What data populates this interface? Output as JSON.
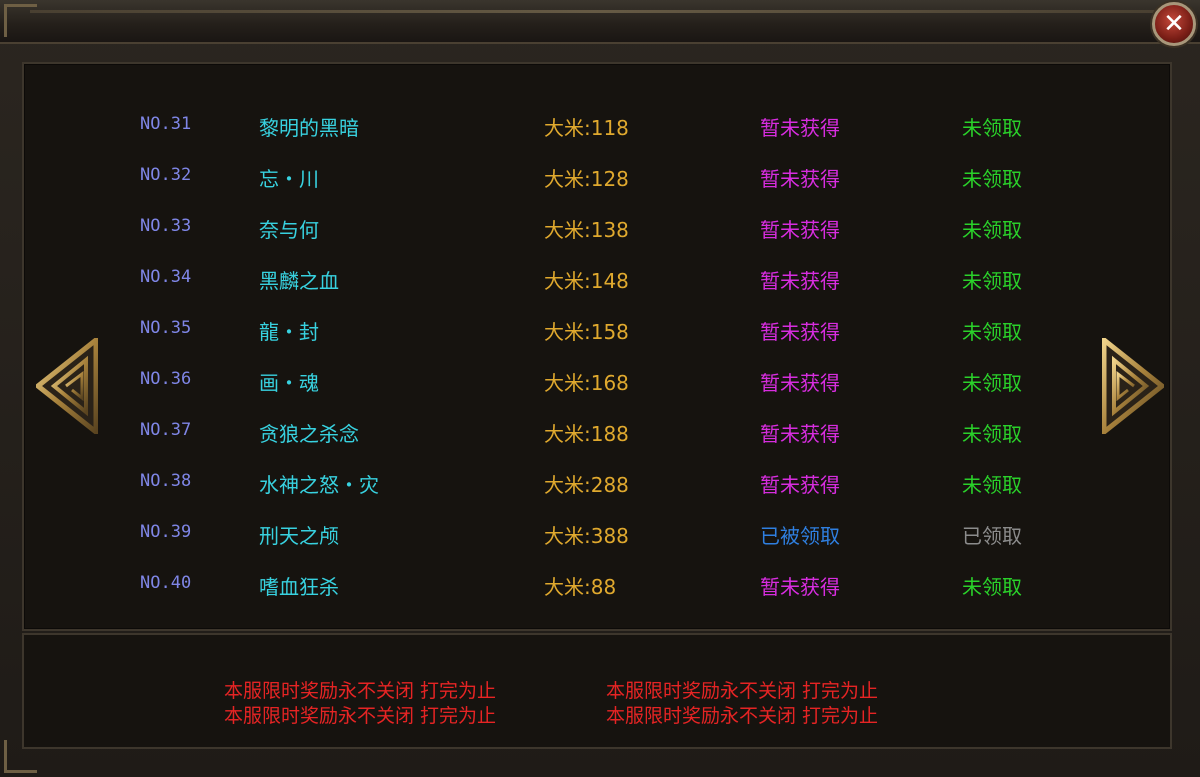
{
  "window": {
    "close_icon": "close-icon",
    "close_glyph": "✕"
  },
  "colors": {
    "no": "#7f86e6",
    "name": "#38d2e0",
    "price": "#e0a92e",
    "not_obtained": "#d82de0",
    "claimed_by_other": "#2f7fe0",
    "unclaimed": "#2ad12a",
    "claimed": "#8c8c8c",
    "notice": "#e62424"
  },
  "rows": [
    {
      "no": "NO.31",
      "name": "黎明的黑暗",
      "price": "大米:118",
      "status": "暂未获得",
      "claim": "未领取",
      "status_type": "not_obtained",
      "claim_type": "unclaimed"
    },
    {
      "no": "NO.32",
      "name": "忘・川",
      "price": "大米:128",
      "status": "暂未获得",
      "claim": "未领取",
      "status_type": "not_obtained",
      "claim_type": "unclaimed"
    },
    {
      "no": "NO.33",
      "name": "奈与何",
      "price": "大米:138",
      "status": "暂未获得",
      "claim": "未领取",
      "status_type": "not_obtained",
      "claim_type": "unclaimed"
    },
    {
      "no": "NO.34",
      "name": "黑麟之血",
      "price": "大米:148",
      "status": "暂未获得",
      "claim": "未领取",
      "status_type": "not_obtained",
      "claim_type": "unclaimed"
    },
    {
      "no": "NO.35",
      "name": "龍・封",
      "price": "大米:158",
      "status": "暂未获得",
      "claim": "未领取",
      "status_type": "not_obtained",
      "claim_type": "unclaimed"
    },
    {
      "no": "NO.36",
      "name": "画・魂",
      "price": "大米:168",
      "status": "暂未获得",
      "claim": "未领取",
      "status_type": "not_obtained",
      "claim_type": "unclaimed"
    },
    {
      "no": "NO.37",
      "name": "贪狼之杀念",
      "price": "大米:188",
      "status": "暂未获得",
      "claim": "未领取",
      "status_type": "not_obtained",
      "claim_type": "unclaimed"
    },
    {
      "no": "NO.38",
      "name": "水神之怒・灾",
      "price": "大米:288",
      "status": "暂未获得",
      "claim": "未领取",
      "status_type": "not_obtained",
      "claim_type": "unclaimed"
    },
    {
      "no": "NO.39",
      "name": "刑天之颅",
      "price": "大米:388",
      "status": "已被领取",
      "claim": "已领取",
      "status_type": "claimed_by_other",
      "claim_type": "claimed"
    },
    {
      "no": "NO.40",
      "name": "嗜血狂杀",
      "price": "大米:88",
      "status": "暂未获得",
      "claim": "未领取",
      "status_type": "not_obtained",
      "claim_type": "unclaimed"
    }
  ],
  "navigation": {
    "prev_icon": "left-arrow-icon",
    "next_icon": "right-arrow-icon"
  },
  "notice": {
    "line1_a": "本服限时奖励永不关闭 打完为止",
    "line1_b": "本服限时奖励永不关闭 打完为止",
    "line2_a": "本服限时奖励永不关闭 打完为止",
    "line2_b": "本服限时奖励永不关闭 打完为止"
  }
}
